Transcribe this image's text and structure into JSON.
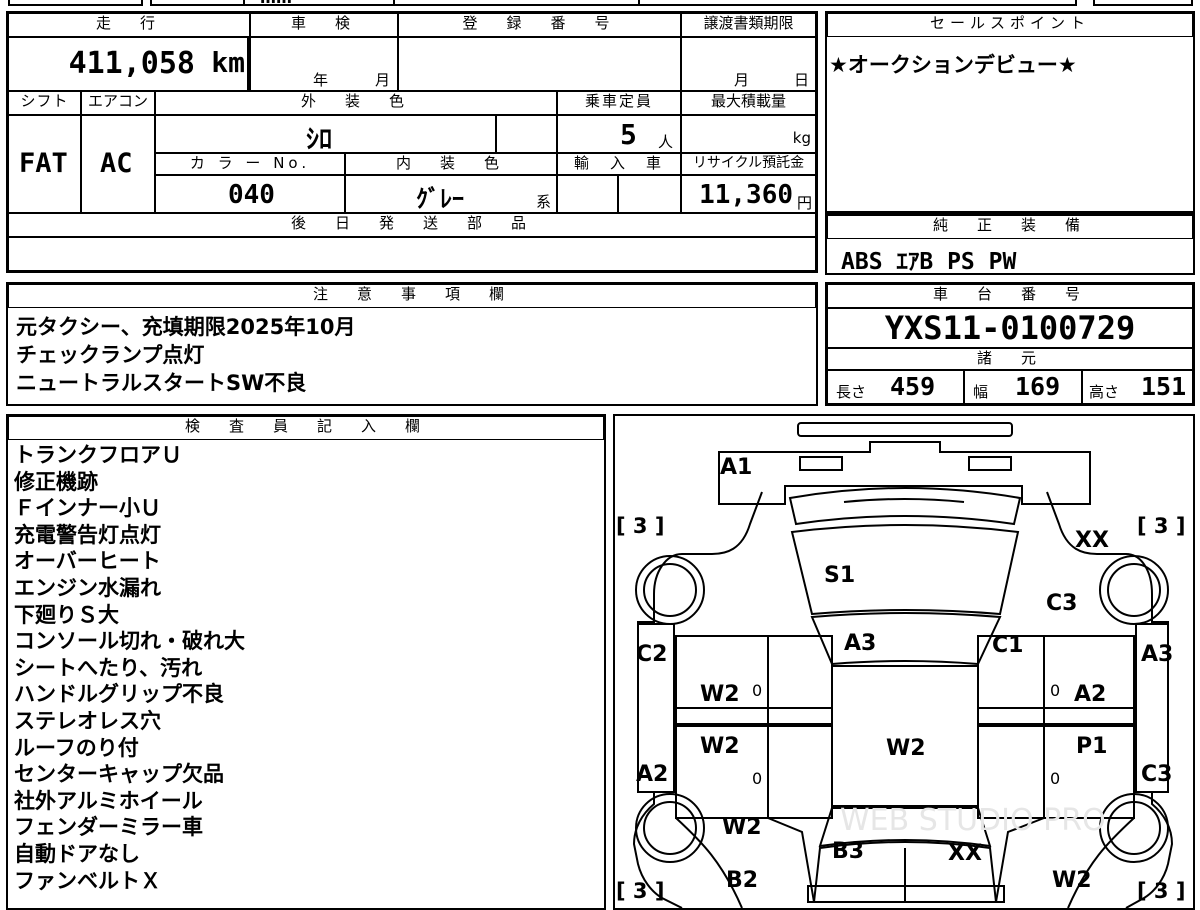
{
  "top_strip": {
    "cut_text": "……"
  },
  "vehicle_info": {
    "mileage_header": "走　行",
    "mileage": "411,058",
    "mileage_unit": "km",
    "inspection_header": "車　検",
    "inspection_year_label": "年",
    "inspection_month_label": "月",
    "registration_header": "登　録　番　号",
    "transfer_deadline_header": "譲渡書類期限",
    "transfer_month_label": "月",
    "transfer_day_label": "日",
    "shift_header": "シフト",
    "shift_value": "FAT",
    "aircon_header": "エアコン",
    "aircon_value": "AC",
    "exterior_color_header": "外　装　色",
    "exterior_color_value": "ｼﾛ",
    "capacity_header": "乗車定員",
    "capacity_value": "5",
    "capacity_unit": "人",
    "max_load_header": "最大積載量",
    "max_load_unit": "kg",
    "color_no_header": "カ ラ ー No.",
    "color_no_value": "040",
    "interior_color_header": "内　装　色",
    "interior_color_value": "ｸﾞﾚｰ",
    "interior_color_suffix": "系",
    "import_header": "輸　入　車",
    "recycle_header": "リサイクル預託金",
    "recycle_value": "11,360",
    "recycle_unit": "円",
    "later_parts_header": "後　日　発　送　部　品"
  },
  "sales_point": {
    "header": "セールスポイント",
    "text": "★オークションデビュー★"
  },
  "genuine_equipment": {
    "header": "純　正　装　備",
    "value": "ABS ｴｱB PS PW"
  },
  "notes": {
    "header": "注　意　事　項　欄",
    "lines": [
      "元タクシー、充填期限2025年10月",
      "チェックランプ点灯",
      "ニュートラルスタートSW不良"
    ]
  },
  "chassis": {
    "header": "車　台　番　号",
    "number": "YXS11-0100729"
  },
  "specs": {
    "header": "諸　元",
    "length_label": "長さ",
    "length": "459",
    "width_label": "幅",
    "width": "169",
    "height_label": "高さ",
    "height": "151"
  },
  "inspector": {
    "header": "検　査　員　記　入　欄",
    "lines": [
      "トランクフロアＵ",
      "修正機跡",
      "Ｆインナー小Ｕ",
      "充電警告灯点灯",
      "オーバーヒート",
      "エンジン水漏れ",
      "下廻りＳ大",
      "コンソール切れ・破れ大",
      "シートへたり、汚れ",
      "ハンドルグリップ不良",
      "ステレオレス穴",
      "ルーフのり付",
      "センターキャップ欠品",
      "社外アルミホイール",
      "フェンダーミラー車",
      "自動ドアなし",
      "ファンベルトＸ"
    ]
  },
  "diagram": {
    "watermark": "WEB STUDIO PRO",
    "tire_top_left": "[ 3 ]",
    "tire_top_right": "[ 3 ]",
    "tire_bottom_left": "[ 3 ]",
    "tire_bottom_right": "[ 3 ]",
    "marks": {
      "front_bumper": "A1",
      "hood": "S1",
      "front_right_fender": "XX",
      "front_right_corner": "C3",
      "front_left_side": "C2",
      "windshield": "A3",
      "right_pillar": "C1",
      "right_front_side": "A3",
      "left_front_door": "W2",
      "right_front_door": "A2",
      "left_rear_door": "W2",
      "roof": "W2",
      "right_rear_door": "P1",
      "left_rear_side": "A2",
      "right_rear_side": "C3",
      "left_rear_fender": "W2",
      "rear_left": "B3",
      "rear_right": "XX",
      "left_rear_bottom": "B2",
      "right_rear_bottom": "W2",
      "handle_l1": "0",
      "handle_l2": "0",
      "handle_r1": "0",
      "handle_r2": "0"
    }
  }
}
